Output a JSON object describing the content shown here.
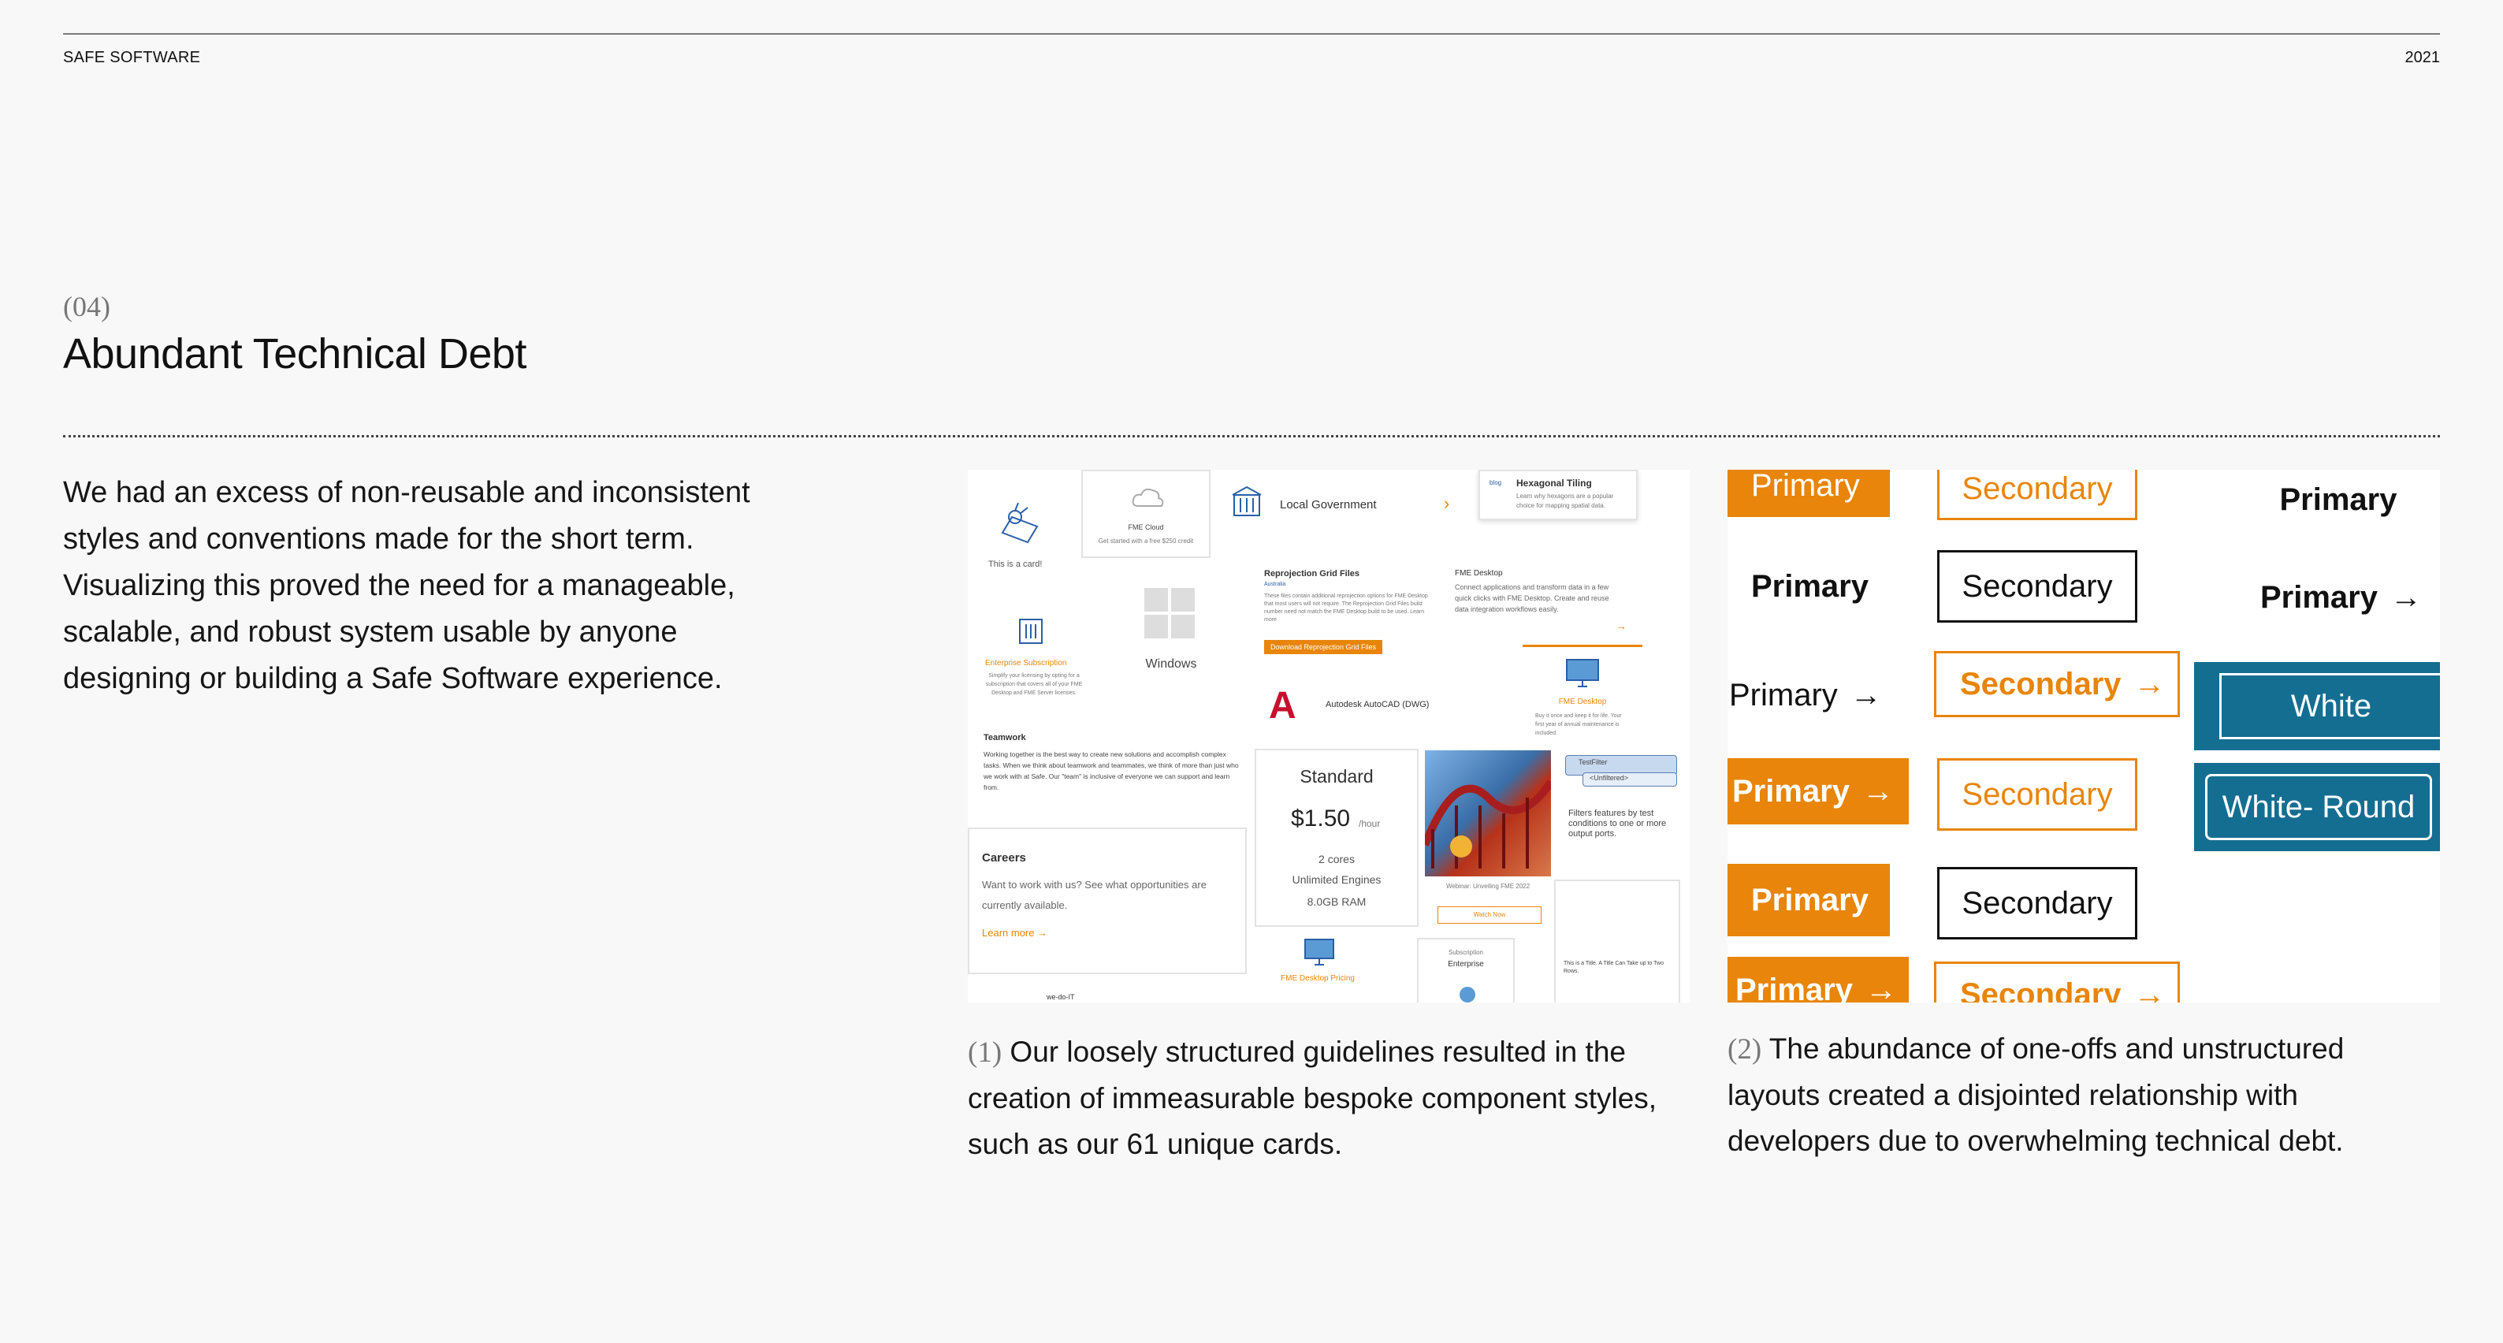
{
  "header": {
    "brand": "SAFE SOFTWARE",
    "year": "2021"
  },
  "section": {
    "number": "(04)",
    "title": "Abundant Technical Debt",
    "body": "We had an excess of non-reusable and inconsistent styles and conventions made for the short term. Visualizing this proved the need for a manageable, scalable, and robust system usable by anyone designing or building a Safe Software experience."
  },
  "cards_collage": {
    "card_simple": "This is a card!",
    "fme_cloud_title": "FME Cloud",
    "fme_cloud_sub": "Get started with a free $250 credit",
    "local_gov": "Local Government",
    "blog_tag": "blog",
    "hex_title": "Hexagonal Tiling",
    "hex_desc": "Learn why hexagons are a popular choice for mapping spatial data.",
    "enterprise_sub_title": "Enterprise Subscription",
    "enterprise_sub_desc": "Simplify your licensing by opting for a subscription that covers all of your FME Desktop and FME Server licenses.",
    "windows": "Windows",
    "reproj_title": "Reprojection Grid Files",
    "reproj_tag": "Australia",
    "reproj_desc": "These files contain additional reprojection options for FME Desktop that most users will not require. The Reprojection Grid Files build number need not match the FME Desktop build to be used. Learn more",
    "reproj_btn": "Download Reprojection Grid Files",
    "fme_desktop_title": "FME Desktop",
    "fme_desktop_desc": "Connect applications and transform data in a few quick clicks with FME Desktop. Create and reuse data integration workflows easily.",
    "autocad": "Autodesk AutoCAD (DWG)",
    "fme_desktop_card2": "FME Desktop",
    "fme_desktop_card2_desc": "Buy it once and keep it for life. Your first year of annual maintenance is included.",
    "teamwork_title": "Teamwork",
    "teamwork_desc": "Working together is the best way to create new solutions and accomplish complex tasks. When we think about teamwork and teammates, we think of more than just who we work with at Safe. Our \"team\" is inclusive of everyone we can support and learn from.",
    "standard": "Standard",
    "price": "$1.50",
    "per_hour": "/hour",
    "cores": "2 cores",
    "engines": "Unlimited Engines",
    "ram": "8.0GB RAM",
    "webinar": "Webinar: Unveiling FME 2022",
    "watch_now": "Watch Now",
    "testfilter": "TestFilter",
    "unfiltered": "<Unfiltered>",
    "filters_desc": "Filters features by test conditions to one or more output ports.",
    "careers_title": "Careers",
    "careers_desc": "Want to work with us? See what opportunities are currently available.",
    "learn_more": "Learn more",
    "fme_desktop_pricing": "FME Desktop Pricing",
    "subscription": "Subscription",
    "enterprise": "Enterprise",
    "wedoit": "we-do-IT",
    "tiny_title": "This is a Title. A Title Can Take up to Two Rows."
  },
  "buttons": {
    "primary": "Primary",
    "secondary": "Secondary",
    "white": "White",
    "white_round": "White- Round",
    "arrow": "→"
  },
  "captions": {
    "c1_num": "(1)",
    "c1_text": " Our loosely structured guidelines resulted in the creation of immeasurable bespoke component styles, such as our 61 unique cards.",
    "c2_num": "(2)",
    "c2_text": " The abundance of one-offs and unstructured layouts created a disjointed relationship with developers due to overwhelming technical debt."
  },
  "colors": {
    "accent": "#e8850a",
    "teal": "#146e92",
    "background": "#f8f8f8"
  }
}
